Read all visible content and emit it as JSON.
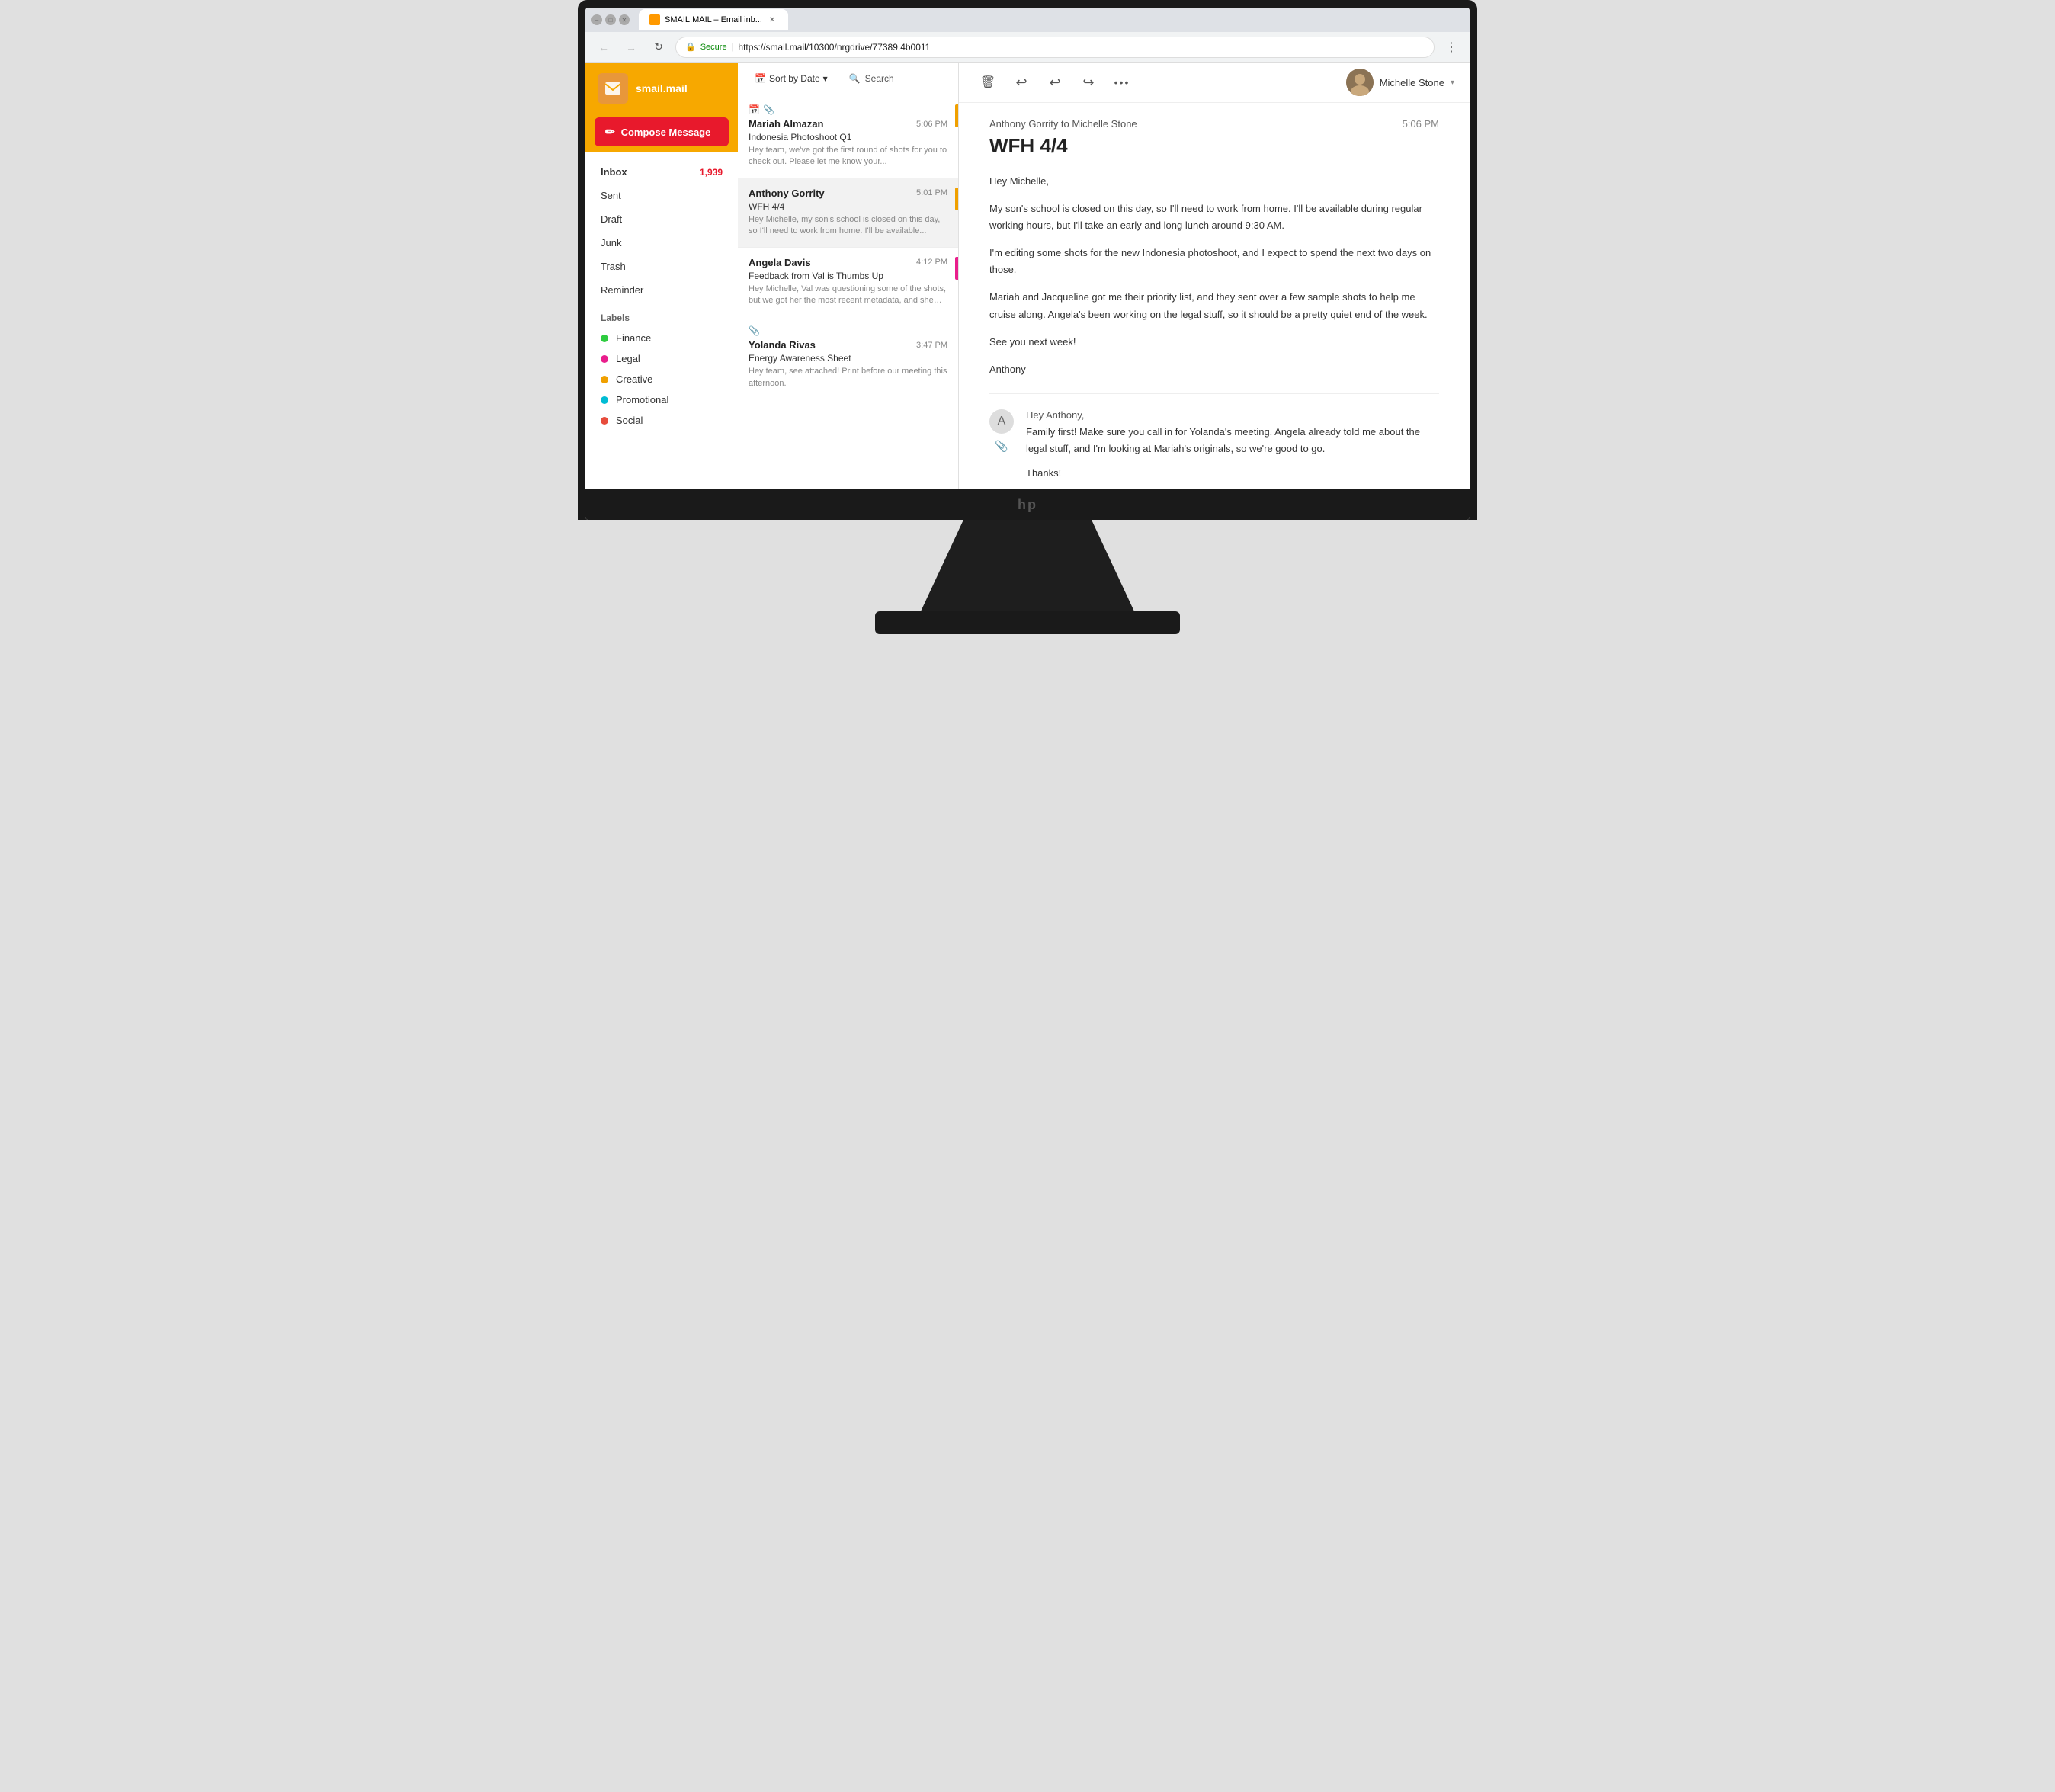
{
  "browser": {
    "tab_title": "SMAIL.MAIL – Email inb...",
    "url": "https://smail.mail/10300/nrgdrive/77389.4b0011",
    "secure_label": "Secure"
  },
  "sidebar": {
    "logo_text": "smail.mail",
    "compose_label": "Compose Message",
    "nav_items": [
      {
        "id": "inbox",
        "label": "Inbox",
        "badge": "1,939",
        "active": true
      },
      {
        "id": "sent",
        "label": "Sent",
        "badge": ""
      },
      {
        "id": "draft",
        "label": "Draft",
        "badge": ""
      },
      {
        "id": "junk",
        "label": "Junk",
        "badge": ""
      },
      {
        "id": "trash",
        "label": "Trash",
        "badge": ""
      },
      {
        "id": "reminder",
        "label": "Reminder",
        "badge": ""
      }
    ],
    "labels_title": "Labels",
    "labels": [
      {
        "id": "finance",
        "label": "Finance",
        "color": "#2ecc40"
      },
      {
        "id": "legal",
        "label": "Legal",
        "color": "#e91e8c"
      },
      {
        "id": "creative",
        "label": "Creative",
        "color": "#f0a000"
      },
      {
        "id": "promotional",
        "label": "Promotional",
        "color": "#00bcd4"
      },
      {
        "id": "social",
        "label": "Social",
        "color": "#e74c3c"
      }
    ]
  },
  "email_list": {
    "sort_label": "Sort by Date",
    "search_label": "Search",
    "emails": [
      {
        "id": "email-1",
        "sender": "Mariah Almazan",
        "subject": "Indonesia Photoshoot Q1",
        "preview": "Hey team, we've got the first round of shots for you to check out. Please let me know your...",
        "time": "5:06 PM",
        "accent_color": "#f0a000",
        "has_calendar": true,
        "has_attachment": true,
        "selected": false
      },
      {
        "id": "email-2",
        "sender": "Anthony Gorrity",
        "subject": "WFH 4/4",
        "preview": "Hey Michelle, my son's school is closed on this day, so I'll need to work from home. I'll be available...",
        "time": "5:01 PM",
        "accent_color": "#f0a000",
        "has_calendar": false,
        "has_attachment": false,
        "selected": true
      },
      {
        "id": "email-3",
        "sender": "Angela Davis",
        "subject": "Feedback from Val is Thumbs Up",
        "preview": "Hey Michelle, Val was questioning some of the shots, but we got her the most recent metadata, and she said...",
        "time": "4:12 PM",
        "accent_color": "#e91e8c",
        "has_calendar": false,
        "has_attachment": false,
        "selected": false
      },
      {
        "id": "email-4",
        "sender": "Yolanda Rivas",
        "subject": "Energy Awareness Sheet",
        "preview": "Hey team, see attached! Print before our meeting this afternoon.",
        "time": "3:47 PM",
        "accent_color": "",
        "has_calendar": false,
        "has_attachment": true,
        "selected": false
      }
    ]
  },
  "email_detail": {
    "from_to": "Anthony Gorrity to Michelle Stone",
    "time": "5:06 PM",
    "subject": "WFH 4/4",
    "body": [
      "Hey Michelle,",
      "My son's school is closed on this day, so I'll need to work from home. I'll be available during regular working hours, but I'll take an early and long lunch around 9:30 AM.",
      "I'm editing some shots for the new Indonesia photoshoot, and I expect to spend the next two days on those.",
      "Mariah and Jacqueline got me their priority list, and they sent over a few sample shots to help me cruise along. Angela's been working on the legal stuff, so it should be a pretty quiet end of the week.",
      "See you next week!",
      "Anthony"
    ],
    "reply": {
      "from": "Hey Anthony,",
      "body": [
        "Family first! Make sure you call in for Yolanda's meeting. Angela already told me about the legal stuff, and I'm looking at Mariah's originals, so we're good to go.",
        "Thanks!"
      ]
    }
  },
  "user": {
    "name": "Michelle Stone"
  },
  "actions": {
    "delete": "🗑",
    "reply": "↩",
    "reply_all": "↪",
    "forward": "↪",
    "more": "•••"
  }
}
